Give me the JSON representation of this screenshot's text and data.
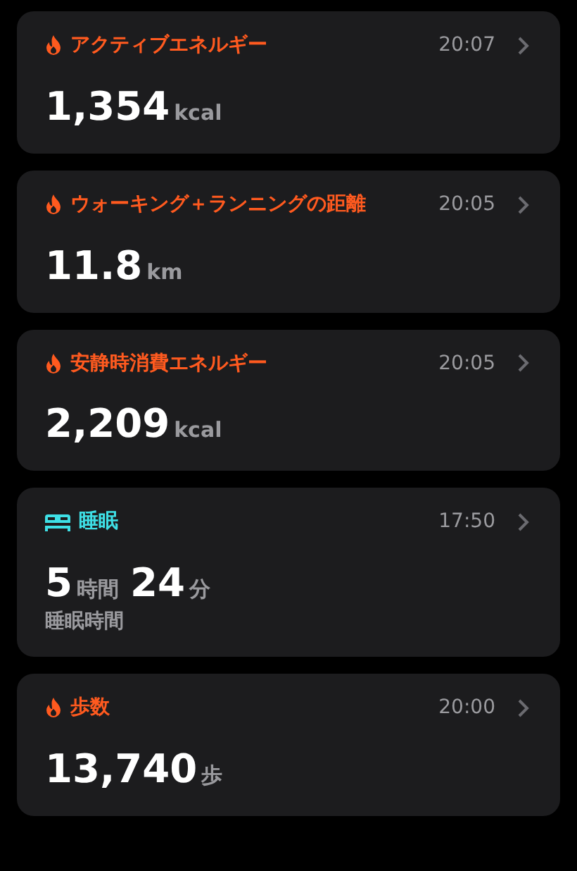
{
  "cards": [
    {
      "kind": "flame",
      "color": "#ff5a1f",
      "title": "アクティブエネルギー",
      "time": "20:07",
      "value": [
        {
          "number": "1,354",
          "unit": "kcal"
        }
      ]
    },
    {
      "kind": "flame",
      "color": "#ff5a1f",
      "title": "ウォーキング＋ランニングの距離",
      "time": "20:05",
      "value": [
        {
          "number": "11.8",
          "unit": "km"
        }
      ]
    },
    {
      "kind": "flame",
      "color": "#ff5a1f",
      "title": "安静時消費エネルギー",
      "time": "20:05",
      "value": [
        {
          "number": "2,209",
          "unit": "kcal"
        }
      ]
    },
    {
      "kind": "bed",
      "color": "#3ee0e6",
      "title": "睡眠",
      "time": "17:50",
      "value": [
        {
          "number": "5",
          "unit": "時間"
        },
        {
          "number": "24",
          "unit": "分"
        }
      ],
      "caption": "睡眠時間"
    },
    {
      "kind": "flame",
      "color": "#ff5a1f",
      "title": "歩数",
      "time": "20:00",
      "value": [
        {
          "number": "13,740",
          "unit": "歩"
        }
      ]
    }
  ]
}
